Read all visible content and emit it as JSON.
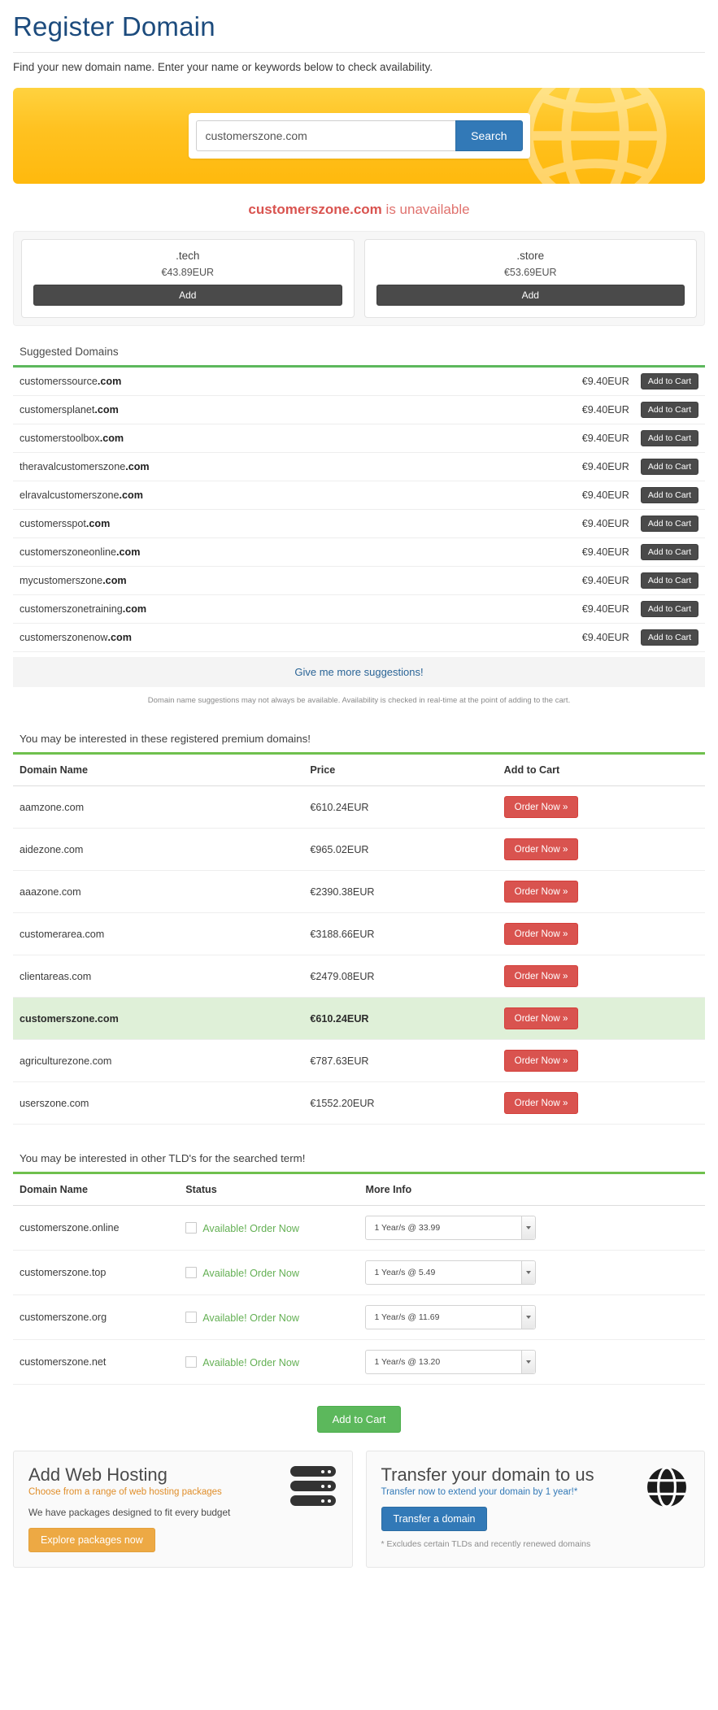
{
  "header": {
    "title": "Register Domain",
    "lead": "Find your new domain name. Enter your name or keywords below to check availability."
  },
  "search": {
    "value": "customerszone.com",
    "placeholder": "",
    "button_label": "Search"
  },
  "availability": {
    "domain": "customerszone.com",
    "status_text": " is unavailable"
  },
  "tld_offers": [
    {
      "tld": ".tech",
      "price": "€43.89EUR",
      "button": "Add"
    },
    {
      "tld": ".store",
      "price": "€53.69EUR",
      "button": "Add"
    }
  ],
  "suggested": {
    "title": "Suggested Domains",
    "add_label": "Add to Cart",
    "rows": [
      {
        "sld": "customerssource",
        "tld": ".com",
        "price": "€9.40EUR"
      },
      {
        "sld": "customersplanet",
        "tld": ".com",
        "price": "€9.40EUR"
      },
      {
        "sld": "customerstoolbox",
        "tld": ".com",
        "price": "€9.40EUR"
      },
      {
        "sld": "theravalcustomerszone",
        "tld": ".com",
        "price": "€9.40EUR"
      },
      {
        "sld": "elravalcustomerszone",
        "tld": ".com",
        "price": "€9.40EUR"
      },
      {
        "sld": "customersspot",
        "tld": ".com",
        "price": "€9.40EUR"
      },
      {
        "sld": "customerszoneonline",
        "tld": ".com",
        "price": "€9.40EUR"
      },
      {
        "sld": "mycustomerszone",
        "tld": ".com",
        "price": "€9.40EUR"
      },
      {
        "sld": "customerszonetraining",
        "tld": ".com",
        "price": "€9.40EUR"
      },
      {
        "sld": "customerszonenow",
        "tld": ".com",
        "price": "€9.40EUR"
      }
    ],
    "more_link": "Give me more suggestions!",
    "disclaimer": "Domain name suggestions may not always be available. Availability is checked in real-time at the point of adding to the cart."
  },
  "premium": {
    "title": "You may be interested in these registered premium domains!",
    "columns": [
      "Domain Name",
      "Price",
      "Add to Cart"
    ],
    "order_label": "Order Now »",
    "rows": [
      {
        "domain": "aamzone.com",
        "price": "€610.24EUR",
        "highlight": false
      },
      {
        "domain": "aidezone.com",
        "price": "€965.02EUR",
        "highlight": false
      },
      {
        "domain": "aaazone.com",
        "price": "€2390.38EUR",
        "highlight": false
      },
      {
        "domain": "customerarea.com",
        "price": "€3188.66EUR",
        "highlight": false
      },
      {
        "domain": "clientareas.com",
        "price": "€2479.08EUR",
        "highlight": false
      },
      {
        "domain": "customerszone.com",
        "price": "€610.24EUR",
        "highlight": true
      },
      {
        "domain": "agriculturezone.com",
        "price": "€787.63EUR",
        "highlight": false
      },
      {
        "domain": "userszone.com",
        "price": "€1552.20EUR",
        "highlight": false
      }
    ]
  },
  "other_tlds": {
    "title": "You may be interested in other TLD's for the searched term!",
    "columns": [
      "Domain Name",
      "Status",
      "More Info"
    ],
    "status_label": "Available! Order Now",
    "rows": [
      {
        "domain": "customerszone.online",
        "status": "Available! Order Now",
        "period": "1 Year/s @ 33.99"
      },
      {
        "domain": "customerszone.top",
        "status": "Available! Order Now",
        "period": "1 Year/s @ 5.49"
      },
      {
        "domain": "customerszone.org",
        "status": "Available! Order Now",
        "period": "1 Year/s @ 11.69"
      },
      {
        "domain": "customerszone.net",
        "status": "Available! Order Now",
        "period": "1 Year/s @ 13.20"
      }
    ],
    "cart_button": "Add to Cart"
  },
  "promos": {
    "hosting": {
      "title": "Add Web Hosting",
      "subtitle": "Choose from a range of web hosting packages",
      "body": "We have packages designed to fit every budget",
      "button": "Explore packages now"
    },
    "transfer": {
      "title": "Transfer your domain to us",
      "subtitle": "Transfer now to extend your domain by 1 year!*",
      "button": "Transfer a domain",
      "footnote": "* Excludes certain TLDs and recently renewed domains"
    }
  },
  "colors": {
    "accent_blue": "#3279b7",
    "hero_yellow": "#ffc221",
    "green": "#5cb85c",
    "red": "#d9534f",
    "title_blue": "#1c4b7d"
  }
}
